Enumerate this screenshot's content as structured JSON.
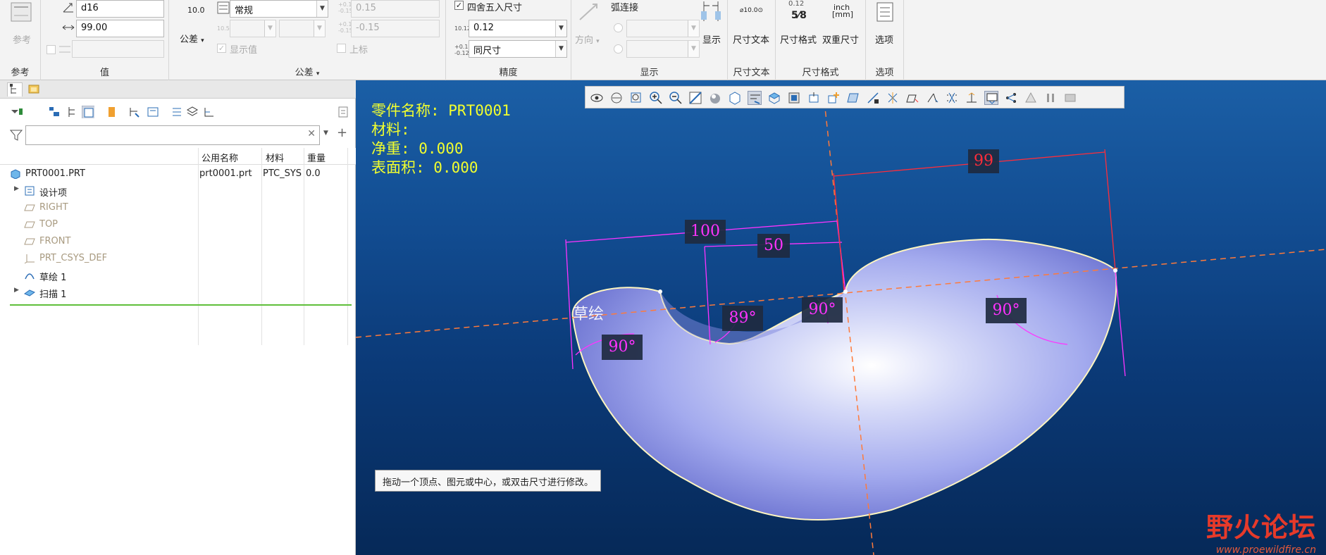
{
  "ribbon": {
    "reference": {
      "label": "参考",
      "group": "参考"
    },
    "value": {
      "name_field": "d16",
      "value_field": "99.00",
      "third_field": "",
      "group": "值"
    },
    "tolerance": {
      "sample": "10.0",
      "button": "公差",
      "mode": "常规",
      "show_value_checkbox": "显示值",
      "upper": "0.15",
      "lower": "-0.15",
      "superscript_checkbox": "上标",
      "group": "公差"
    },
    "precision": {
      "rounding_checkbox": "四舍五入尺寸",
      "rounding_checked": true,
      "decimal": "0.12",
      "tol_decimal": "同尺寸",
      "group": "精度"
    },
    "display": {
      "direction": "方向",
      "arc_connect": "弧连接",
      "display_button": "显示",
      "group": "显示"
    },
    "dim_text": {
      "sample": "⌀10.0⊙",
      "button": "尺寸文本",
      "group": "尺寸文本"
    },
    "dim_format": {
      "frac_top": "0.12",
      "frac_bottom": "5⁄8",
      "button": "尺寸格式",
      "dual_sample_top": "inch",
      "dual_sample_bottom": "[mm]",
      "dual_button": "双重尺寸",
      "group": "尺寸格式"
    },
    "options": {
      "button": "选项",
      "group": "选项"
    }
  },
  "model_tree": {
    "columns": [
      "公用名称",
      "材料",
      "重量"
    ],
    "root": {
      "name": "PRT0001.PRT",
      "common_name": "prt0001.prt",
      "material": "PTC_SYS",
      "weight": "0.0"
    },
    "items": [
      {
        "label": "设计项",
        "muted": false
      },
      {
        "label": "RIGHT",
        "muted": true
      },
      {
        "label": "TOP",
        "muted": true
      },
      {
        "label": "FRONT",
        "muted": true
      },
      {
        "label": "PRT_CSYS_DEF",
        "muted": true
      },
      {
        "label": "草绘 1",
        "muted": false
      },
      {
        "label": "扫描 1",
        "muted": false
      }
    ]
  },
  "graphics": {
    "info_lines": [
      "零件名称: PRT0001",
      "材料:",
      "净重: 0.000",
      "表面积: 0.000"
    ],
    "sketch_label": "草绘",
    "dims": {
      "d99": "99",
      "d100": "100",
      "d50": "50",
      "a89": "89°",
      "a90_left": "90°",
      "a90_mid": "90°",
      "a90_right": "90°"
    },
    "tooltip": "拖动一个顶点、图元或中心，或双击尺寸进行修改。",
    "watermark_main": "野火论坛",
    "watermark_sub": "www.proewildfire.cn"
  },
  "colors": {
    "dim_magenta": "#ff33ff",
    "dim_red": "#ff2d3a",
    "info_yellow": "#f2ff2e",
    "surface": "#a9b0f0"
  }
}
